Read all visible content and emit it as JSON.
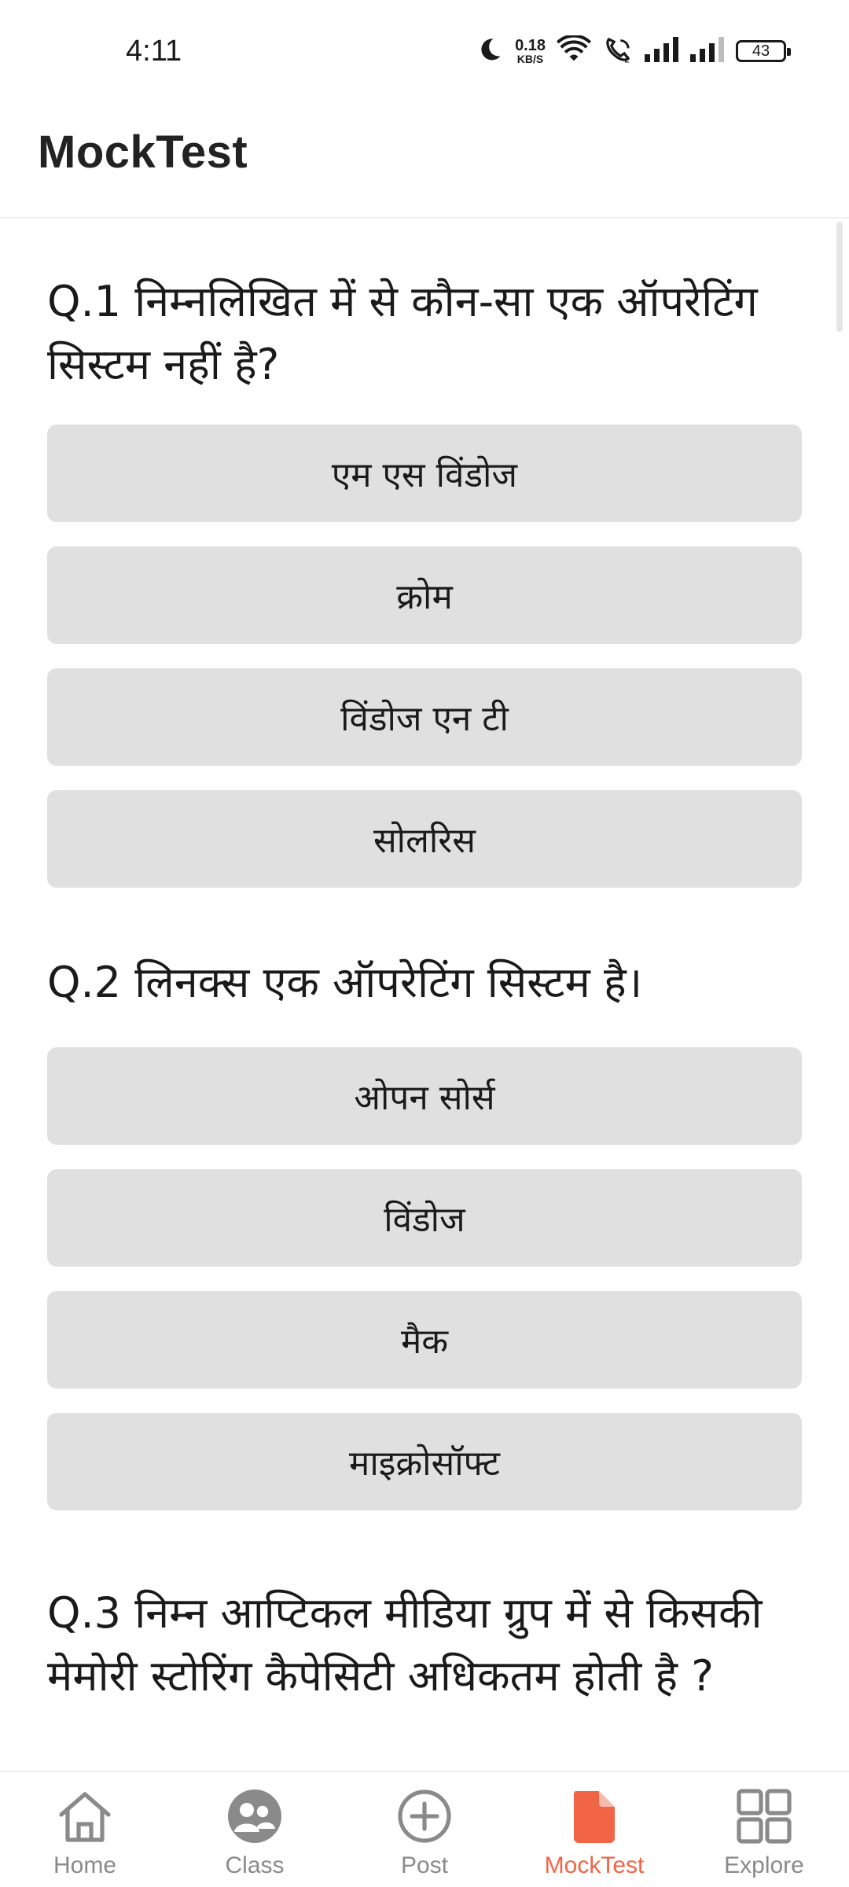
{
  "status_bar": {
    "time": "4:11",
    "net_speed_value": "0.18",
    "net_speed_unit": "KB/S",
    "battery_level": "43",
    "icons": [
      "moon-icon",
      "wifi-icon",
      "wifi-calling-icon",
      "signal-icon",
      "signal-icon"
    ]
  },
  "app_bar": {
    "title": "MockTest"
  },
  "questions": [
    {
      "text": "Q.1 निम्नलिखित में से कौन-सा एक ऑपरेटिंग सिस्टम नहीं है?",
      "options": [
        "एम एस विंडोज",
        "क्रोम",
        "विंडोज एन टी",
        "सोलरिस"
      ]
    },
    {
      "text": "Q.2 लिनक्स एक ऑपरेटिंग सिस्टम है।",
      "options": [
        "ओपन सोर्स",
        "विंडोज",
        "मैक",
        "माइक्रोसॉफ्ट"
      ]
    },
    {
      "text": "Q.3 निम्न आप्टिकल मीडिया ग्रुप में से किसकी मेमोरी स्टोरिंग कैपेसिटी अधिकतम होती है ?",
      "options": []
    }
  ],
  "bottom_nav": {
    "active": "MockTest",
    "active_color": "#f26446",
    "inactive_color": "#8a8a8a",
    "items": [
      {
        "label": "Home",
        "icon": "home-icon"
      },
      {
        "label": "Class",
        "icon": "class-icon"
      },
      {
        "label": "Post",
        "icon": "add-circle-icon"
      },
      {
        "label": "MockTest",
        "icon": "document-icon"
      },
      {
        "label": "Explore",
        "icon": "grid-icon"
      }
    ]
  },
  "colors": {
    "option_background": "#e0e0e0",
    "accent": "#f26446"
  }
}
